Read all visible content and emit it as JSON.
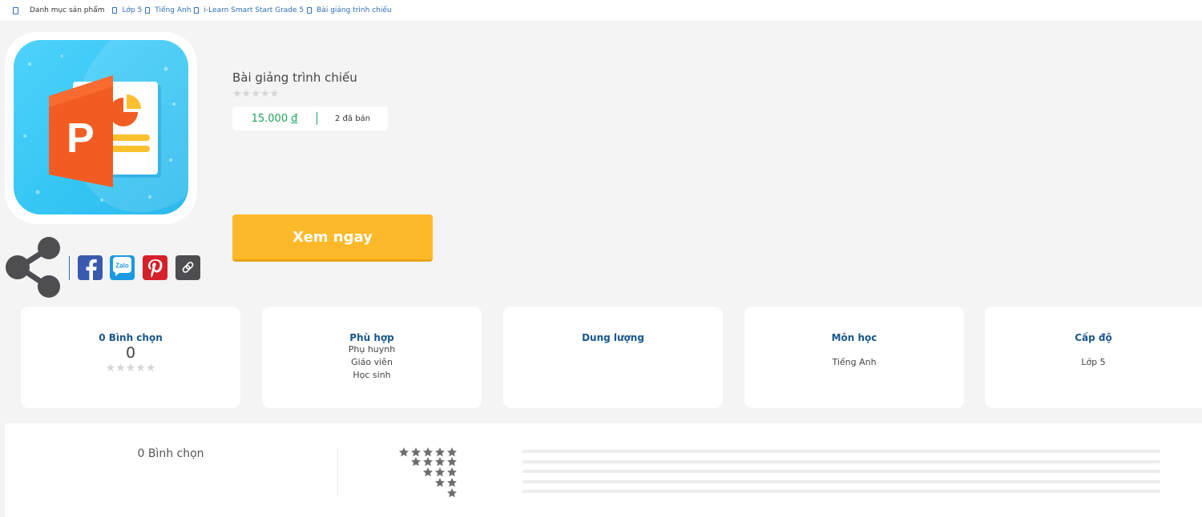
{
  "breadcrumb": {
    "root": "Danh mục sản phẩm",
    "items": [
      "Lớp 5",
      "Tiếng Anh",
      "i-Learn Smart Start Grade 5",
      "Bài giảng trình chiếu"
    ]
  },
  "product": {
    "title": "Bài giảng trình chiếu",
    "rating_stars": 0,
    "price": "15.000",
    "currency": "đ",
    "sold": "2 đã bán",
    "cta_label": "Xem ngay",
    "image_icon": "powerpoint-app-icon"
  },
  "share": {
    "icons": [
      "share-icon",
      "facebook-icon",
      "zalo-icon",
      "pinterest-icon",
      "copy-link-icon"
    ],
    "zalo_text": "Zalo"
  },
  "info_cards": {
    "votes": {
      "title": "0 Bình chọn",
      "value": "0"
    },
    "suitable": {
      "title": "Phù hợp",
      "values": [
        "Phụ huynh",
        "Giáo viên",
        "Học sinh"
      ]
    },
    "size": {
      "title": "Dung lượng"
    },
    "subject": {
      "title": "Môn học",
      "value": "Tiếng Anh"
    },
    "level": {
      "title": "Cấp độ",
      "value": "Lớp 5"
    }
  },
  "reviews": {
    "count_label": "0 Bình chọn",
    "star_levels": [
      5,
      4,
      3,
      2,
      1
    ]
  },
  "colors": {
    "accent_blue": "#18578c",
    "link_blue": "#2d6fb4",
    "price_green": "#1f9e5a",
    "cta_orange": "#fdb929",
    "tile_blue": "#36c6f4",
    "ppt_orange": "#f25c22"
  }
}
